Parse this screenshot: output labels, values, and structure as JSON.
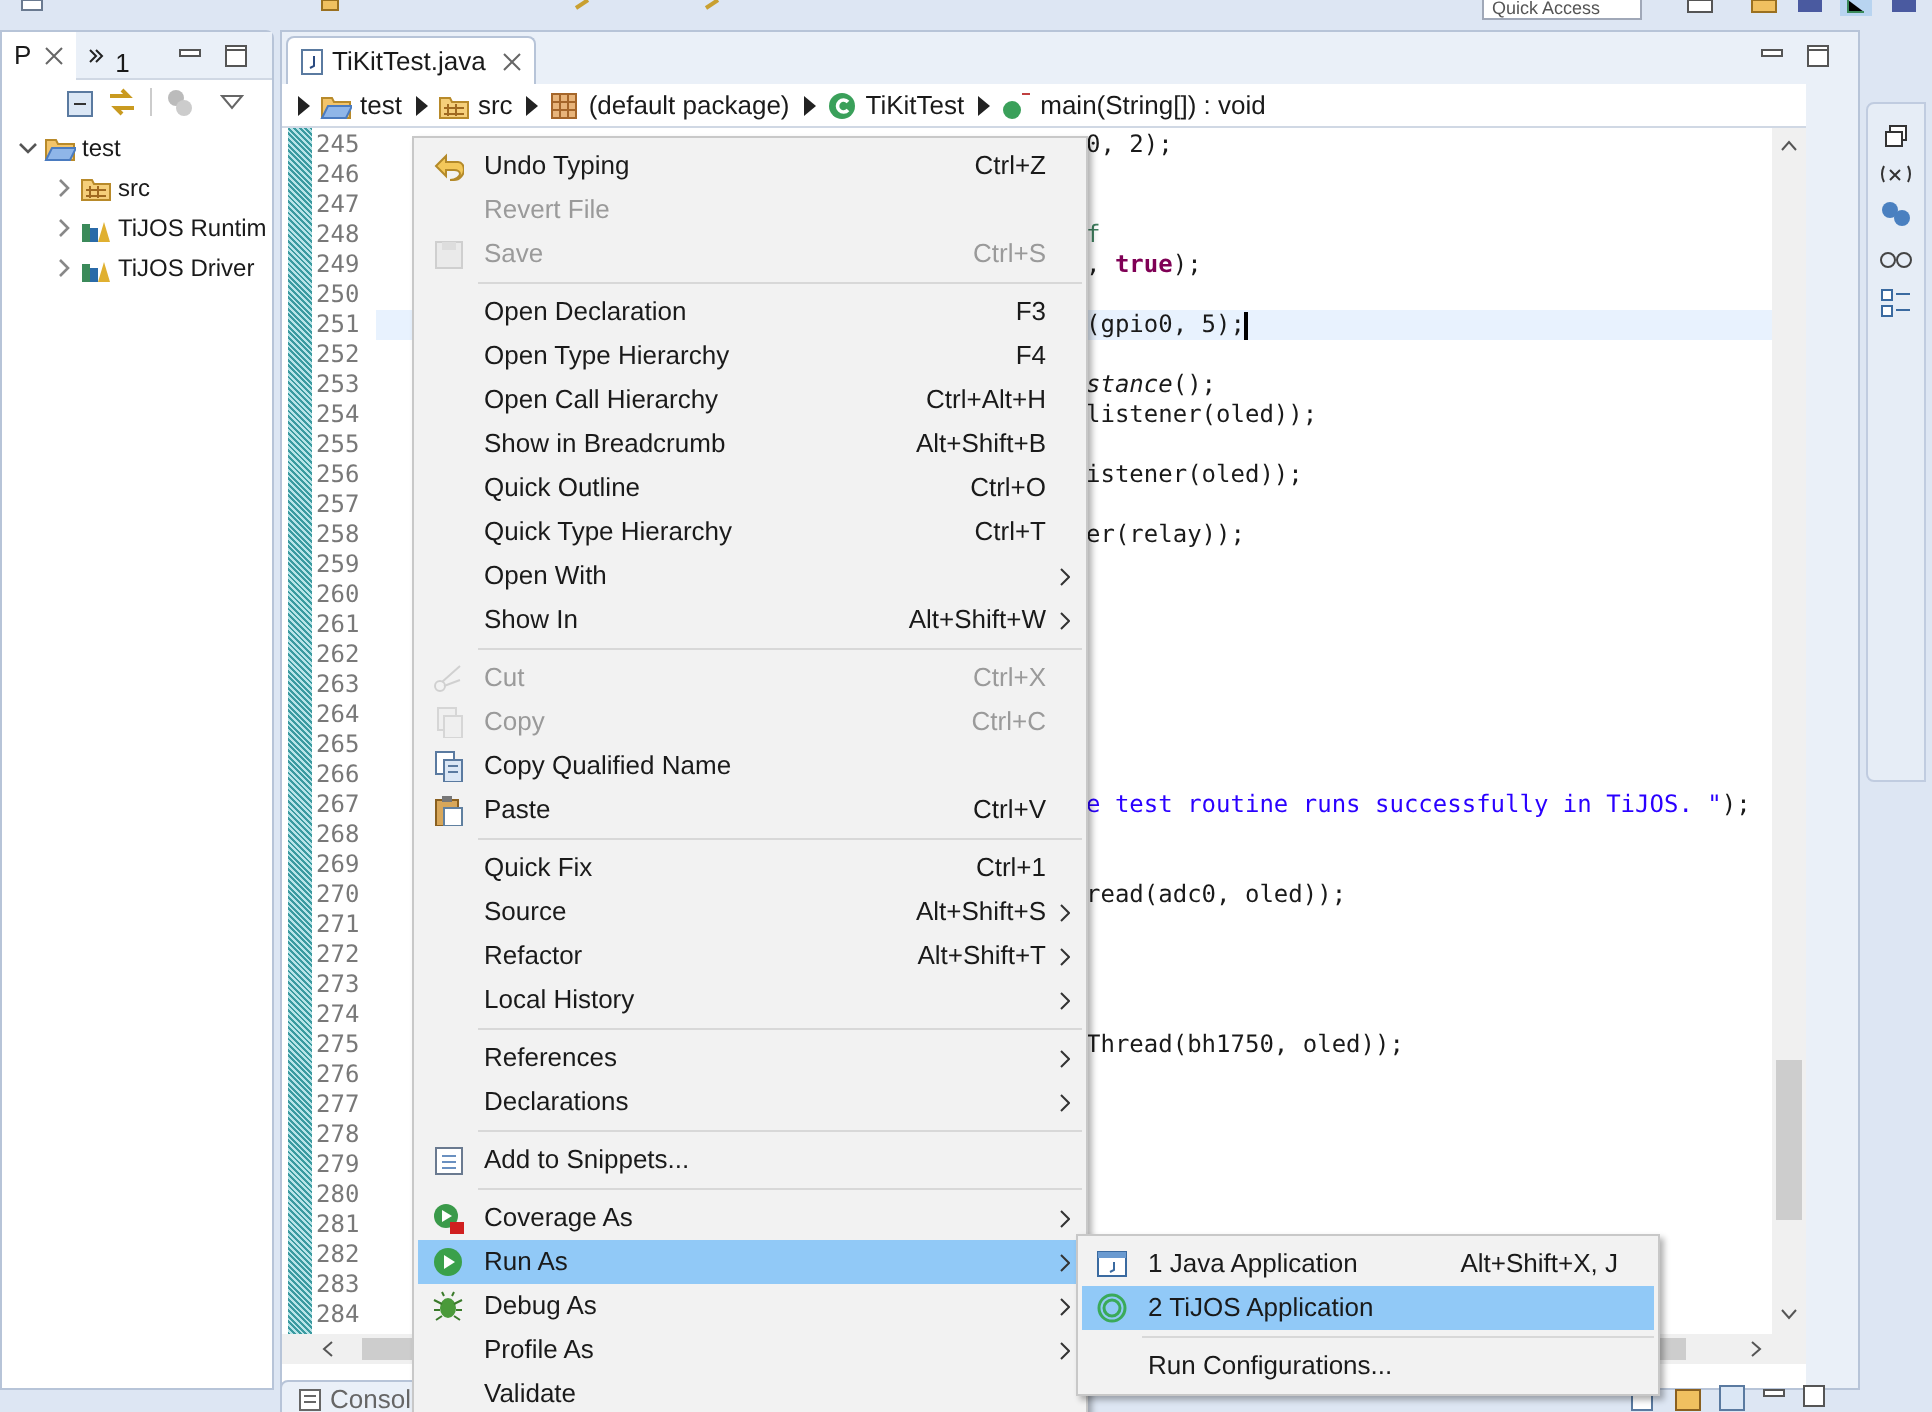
{
  "toolbar": {
    "quick_access": "Quick Access"
  },
  "left_panel": {
    "tabs": [
      {
        "label": "P",
        "selected": true
      },
      {
        "label": "1",
        "selected": false
      }
    ],
    "tree": [
      {
        "label": "test",
        "expanded": true,
        "kind": "project",
        "children": [
          {
            "label": "src",
            "expanded": false,
            "kind": "package"
          },
          {
            "label": "TiJOS Runtim",
            "expanded": false,
            "kind": "library"
          },
          {
            "label": "TiJOS Driver",
            "expanded": false,
            "kind": "library"
          }
        ]
      }
    ]
  },
  "editor": {
    "tab": {
      "label": "TiKitTest.java",
      "selected": true
    },
    "breadcrumb": [
      {
        "label": "test",
        "kind": "project"
      },
      {
        "label": "src",
        "kind": "package"
      },
      {
        "label": "(default package)",
        "kind": "default-package"
      },
      {
        "label": "TiKitTest",
        "kind": "class"
      },
      {
        "label": "main(String[]) : void",
        "kind": "method"
      }
    ],
    "lines": [
      {
        "number": "245",
        "code": [
          {
            "t": "0, 2);",
            "kind": "plain"
          }
        ]
      },
      {
        "number": "246"
      },
      {
        "number": "247"
      },
      {
        "number": "248",
        "code": [
          {
            "t": "f",
            "kind": "comment"
          }
        ]
      },
      {
        "number": "249",
        "code": [
          {
            "t": ", ",
            "kind": "plain"
          },
          {
            "t": "true",
            "kind": "keyword"
          },
          {
            "t": ");",
            "kind": "plain"
          }
        ]
      },
      {
        "number": "250"
      },
      {
        "number": "251",
        "current": true,
        "code": [
          {
            "t": "(gpio0, 5);",
            "kind": "plain"
          }
        ]
      },
      {
        "number": "252"
      },
      {
        "number": "253",
        "code": [
          {
            "t": "stance",
            "kind": "static"
          },
          {
            "t": "();",
            "kind": "plain"
          }
        ]
      },
      {
        "number": "254",
        "code": [
          {
            "t": "listener(oled));",
            "kind": "plain"
          }
        ]
      },
      {
        "number": "255"
      },
      {
        "number": "256",
        "code": [
          {
            "t": "istener(oled));",
            "kind": "plain"
          }
        ]
      },
      {
        "number": "257"
      },
      {
        "number": "258",
        "code": [
          {
            "t": "er(relay));",
            "kind": "plain"
          }
        ]
      },
      {
        "number": "259"
      },
      {
        "number": "260"
      },
      {
        "number": "261"
      },
      {
        "number": "262"
      },
      {
        "number": "263"
      },
      {
        "number": "264"
      },
      {
        "number": "265"
      },
      {
        "number": "266"
      },
      {
        "number": "267",
        "code": [
          {
            "t": "e test routine runs successfully in TiJOS. \"",
            "kind": "string"
          },
          {
            "t": ");",
            "kind": "plain"
          }
        ]
      },
      {
        "number": "268"
      },
      {
        "number": "269"
      },
      {
        "number": "270",
        "code": [
          {
            "t": "read(adc0, oled));",
            "kind": "plain"
          }
        ]
      },
      {
        "number": "271"
      },
      {
        "number": "272"
      },
      {
        "number": "273"
      },
      {
        "number": "274"
      },
      {
        "number": "275",
        "code": [
          {
            "t": "Thread(bh1750, oled));",
            "kind": "plain"
          }
        ]
      },
      {
        "number": "276"
      },
      {
        "number": "277"
      },
      {
        "number": "278"
      },
      {
        "number": "279"
      },
      {
        "number": "280"
      },
      {
        "number": "281"
      },
      {
        "number": "282"
      },
      {
        "number": "283"
      },
      {
        "number": "284"
      }
    ]
  },
  "bottom_panel": {
    "tab": "Consol"
  },
  "context_menu": [
    {
      "kind": "undo",
      "label": "Undo Typing",
      "shortcut": "Ctrl+Z",
      "disabled": false,
      "submenu": false,
      "selected": false
    },
    {
      "kind": "plain",
      "label": "Revert File",
      "disabled": true,
      "submenu": false,
      "selected": false
    },
    {
      "kind": "save",
      "label": "Save",
      "shortcut": "Ctrl+S",
      "disabled": true,
      "submenu": false,
      "selected": false
    },
    {
      "kind": "separator"
    },
    {
      "kind": "plain",
      "label": "Open Declaration",
      "shortcut": "F3",
      "disabled": false,
      "submenu": false,
      "selected": false
    },
    {
      "kind": "plain",
      "label": "Open Type Hierarchy",
      "shortcut": "F4",
      "disabled": false,
      "submenu": false,
      "selected": false
    },
    {
      "kind": "plain",
      "label": "Open Call Hierarchy",
      "shortcut": "Ctrl+Alt+H",
      "disabled": false,
      "submenu": false,
      "selected": false
    },
    {
      "kind": "plain",
      "label": "Show in Breadcrumb",
      "shortcut": "Alt+Shift+B",
      "disabled": false,
      "submenu": false,
      "selected": false
    },
    {
      "kind": "plain",
      "label": "Quick Outline",
      "shortcut": "Ctrl+O",
      "disabled": false,
      "submenu": false,
      "selected": false
    },
    {
      "kind": "plain",
      "label": "Quick Type Hierarchy",
      "shortcut": "Ctrl+T",
      "disabled": false,
      "submenu": false,
      "selected": false
    },
    {
      "kind": "plain",
      "label": "Open With",
      "disabled": false,
      "submenu": true,
      "selected": false
    },
    {
      "kind": "plain",
      "label": "Show In",
      "shortcut": "Alt+Shift+W",
      "disabled": false,
      "submenu": true,
      "selected": false
    },
    {
      "kind": "separator"
    },
    {
      "kind": "cut",
      "label": "Cut",
      "shortcut": "Ctrl+X",
      "disabled": true,
      "submenu": false,
      "selected": false
    },
    {
      "kind": "copy",
      "label": "Copy",
      "shortcut": "Ctrl+C",
      "disabled": true,
      "submenu": false,
      "selected": false
    },
    {
      "kind": "copy-name",
      "label": "Copy Qualified Name",
      "disabled": false,
      "submenu": false,
      "selected": false
    },
    {
      "kind": "paste",
      "label": "Paste",
      "shortcut": "Ctrl+V",
      "disabled": false,
      "submenu": false,
      "selected": false
    },
    {
      "kind": "separator"
    },
    {
      "kind": "plain",
      "label": "Quick Fix",
      "shortcut": "Ctrl+1",
      "disabled": false,
      "submenu": false,
      "selected": false
    },
    {
      "kind": "plain",
      "label": "Source",
      "shortcut": "Alt+Shift+S",
      "disabled": false,
      "submenu": true,
      "selected": false
    },
    {
      "kind": "plain",
      "label": "Refactor",
      "shortcut": "Alt+Shift+T",
      "disabled": false,
      "submenu": true,
      "selected": false
    },
    {
      "kind": "plain",
      "label": "Local History",
      "disabled": false,
      "submenu": true,
      "selected": false
    },
    {
      "kind": "separator"
    },
    {
      "kind": "plain",
      "label": "References",
      "disabled": false,
      "submenu": true,
      "selected": false
    },
    {
      "kind": "plain",
      "label": "Declarations",
      "disabled": false,
      "submenu": true,
      "selected": false
    },
    {
      "kind": "separator"
    },
    {
      "kind": "snippet",
      "label": "Add to Snippets...",
      "disabled": false,
      "submenu": false,
      "selected": false
    },
    {
      "kind": "separator"
    },
    {
      "kind": "coverage",
      "label": "Coverage As",
      "disabled": false,
      "submenu": true,
      "selected": false
    },
    {
      "kind": "run",
      "label": "Run As",
      "disabled": false,
      "submenu": true,
      "selected": true
    },
    {
      "kind": "debug",
      "label": "Debug As",
      "disabled": false,
      "submenu": true,
      "selected": false
    },
    {
      "kind": "plain",
      "label": "Profile As",
      "disabled": false,
      "submenu": true,
      "selected": false
    },
    {
      "kind": "plain",
      "label": "Validate",
      "disabled": false,
      "submenu": false,
      "selected": false
    }
  ],
  "submenu": [
    {
      "kind": "java-app",
      "label": "1 Java Application",
      "shortcut": "Alt+Shift+X, J",
      "selected": false
    },
    {
      "kind": "tijos-app",
      "label": "2 TiJOS Application",
      "selected": true
    },
    {
      "kind": "separator"
    },
    {
      "kind": "plain",
      "label": "Run Configurations...",
      "selected": false
    }
  ]
}
